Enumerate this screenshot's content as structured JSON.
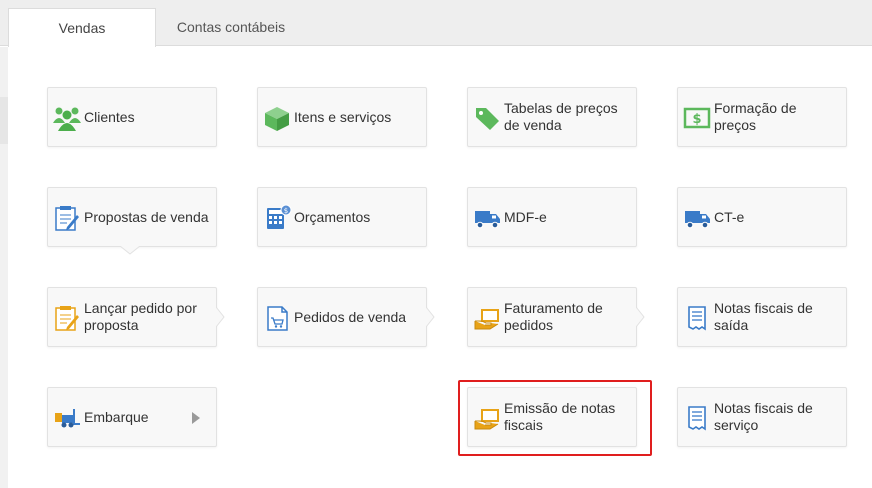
{
  "tabs": [
    {
      "label": "Vendas",
      "active": true
    },
    {
      "label": "Contas contábeis",
      "active": false
    }
  ],
  "cards": [
    {
      "label": "Clientes",
      "icon": "users-icon"
    },
    {
      "label": "Itens e serviços",
      "icon": "box-icon"
    },
    {
      "label": "Tabelas de preços de venda",
      "icon": "price-tag-icon"
    },
    {
      "label": "Formação de preços",
      "icon": "dollar-bill-icon"
    },
    {
      "label": "Propostas de venda",
      "icon": "proposal-document-icon"
    },
    {
      "label": "Orçamentos",
      "icon": "calculator-icon"
    },
    {
      "label": "MDF-e",
      "icon": "truck-icon"
    },
    {
      "label": "CT-e",
      "icon": "truck-icon"
    },
    {
      "label": "Lançar pedido por proposta",
      "icon": "proposal-pencil-icon"
    },
    {
      "label": "Pedidos de venda",
      "icon": "sales-order-icon"
    },
    {
      "label": "Faturamento de pedidos",
      "icon": "hand-invoice-icon"
    },
    {
      "label": "Notas fiscais de saída",
      "icon": "receipt-icon"
    },
    {
      "label": "Embarque",
      "icon": "forklift-icon"
    },
    {
      "label": "Emissão de notas fiscais",
      "icon": "hand-invoice-icon",
      "highlighted": true
    },
    {
      "label": "Notas fiscais de serviço",
      "icon": "receipt-icon"
    }
  ],
  "colors": {
    "green": "#5cb85c",
    "blue": "#3a7bc8",
    "gold": "#e8a317",
    "highlight": "#e01e1e"
  }
}
